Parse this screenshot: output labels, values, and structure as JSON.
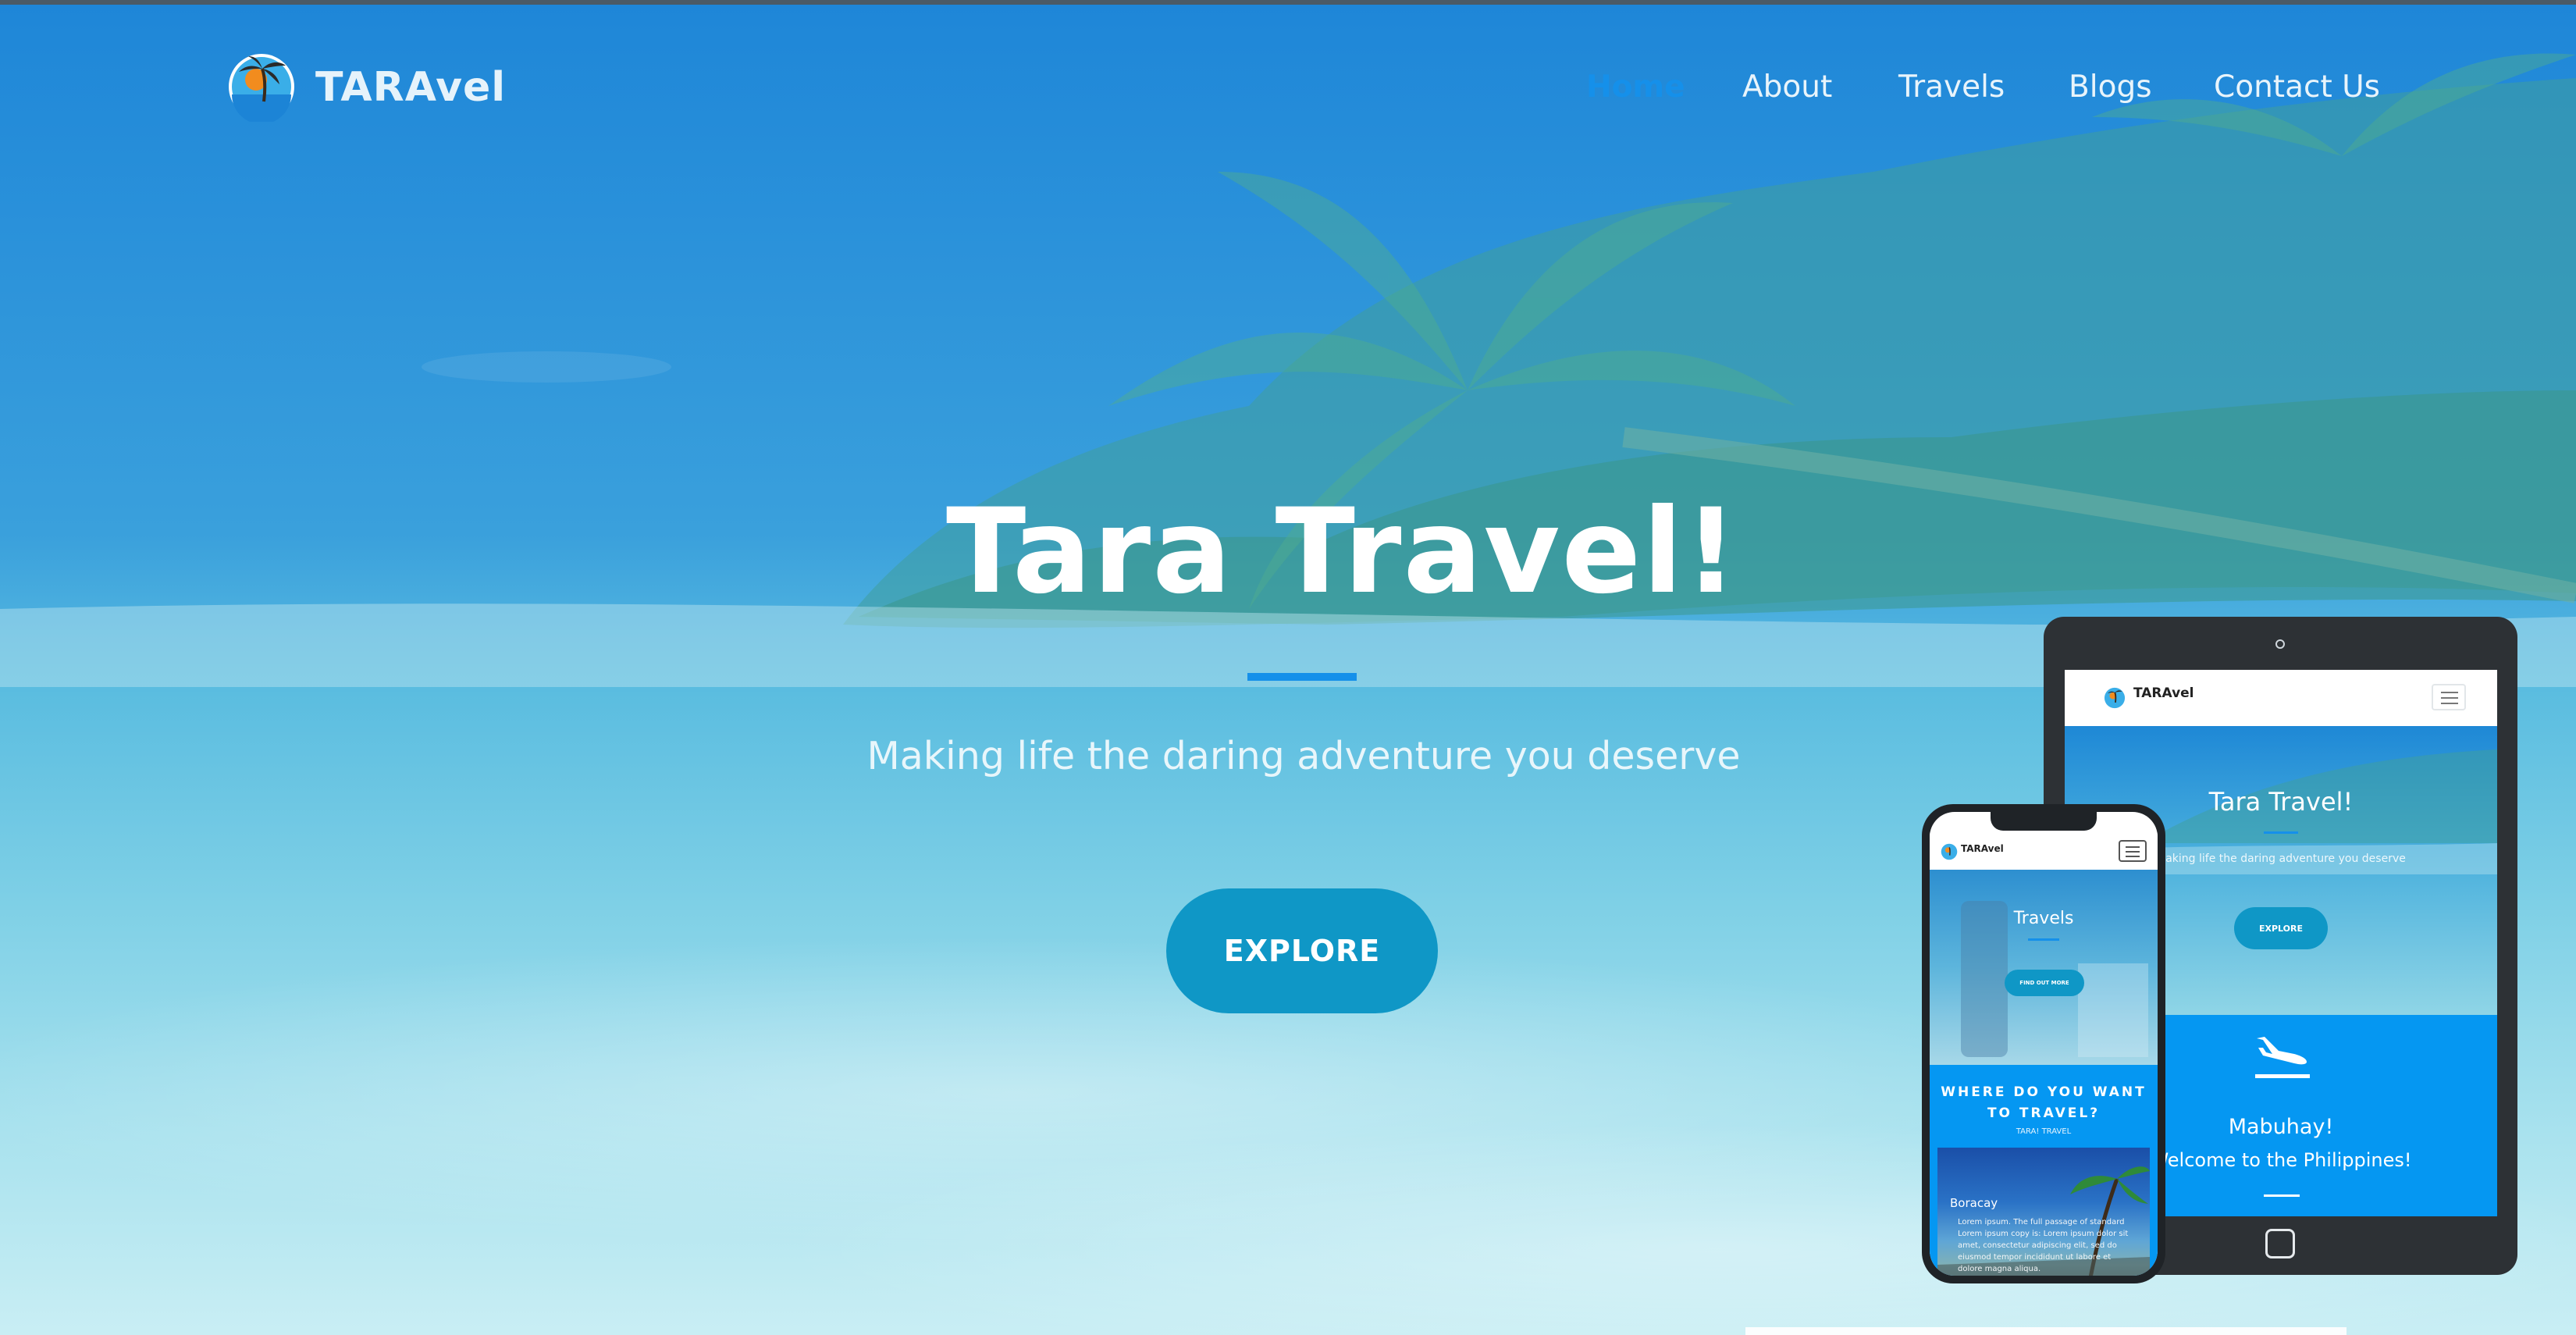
{
  "site": {
    "brand": "TARAvel",
    "nav": {
      "home": "Home",
      "about": "About",
      "travels": "Travels",
      "blogs": "Blogs",
      "contact": "Contact Us"
    }
  },
  "hero": {
    "title": "Tara Travel!",
    "subtitle": "Making life the daring adventure you deserve",
    "cta": "EXPLORE"
  },
  "tablet_preview": {
    "brand": "TARAvel",
    "title": "Tara Travel!",
    "subtitle": "Making life the daring adventure you deserve",
    "cta": "EXPLORE",
    "section_title": "Mabuhay!",
    "section_text": "Welcome to the Philippines!"
  },
  "phone_preview": {
    "brand": "TARAvel",
    "hero_title": "Travels",
    "cta": "FIND OUT MORE",
    "section_title": "WHERE DO YOU WANT TO TRAVEL?",
    "section_sub": "TARA! TRAVEL",
    "card_title": "Boracay",
    "card_text": "Lorem ipsum. The full passage of standard Lorem ipsum copy is: Lorem ipsum dolor sit amet, consectetur adipiscing elit, sed do eiusmod tempor incididunt ut labore et dolore magna aliqua."
  },
  "colors": {
    "accent": "#1590ea",
    "button": "#0f97c6",
    "section_blue": "#0597f2",
    "text_light": "#e8f4fb"
  }
}
